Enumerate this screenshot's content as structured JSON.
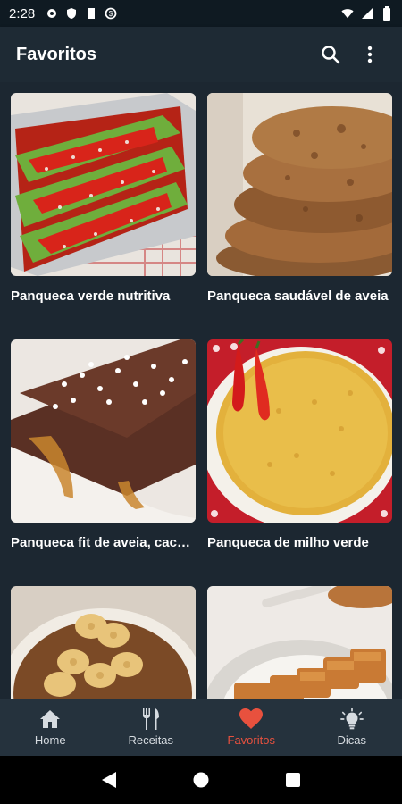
{
  "status_bar": {
    "time": "2:28"
  },
  "app_bar": {
    "title": "Favoritos",
    "icons": [
      "search-icon",
      "more-vert-icon"
    ]
  },
  "recipes": [
    {
      "title": "Panqueca verde nutritiva"
    },
    {
      "title": "Panqueca saudável de aveia"
    },
    {
      "title": "Panqueca fit de aveia, cacau e coco"
    },
    {
      "title": "Panqueca de milho verde"
    },
    {
      "title": ""
    },
    {
      "title": ""
    }
  ],
  "bottom_nav": {
    "items": [
      {
        "label": "Home",
        "icon": "home-icon"
      },
      {
        "label": "Receitas",
        "icon": "fork-knife-icon"
      },
      {
        "label": "Favoritos",
        "icon": "heart-icon",
        "active": true
      },
      {
        "label": "Dicas",
        "icon": "lightbulb-icon"
      }
    ],
    "active_color": "#e8513e"
  },
  "colors": {
    "background": "#1c2731",
    "app_bar": "#1e2a34",
    "bottom_nav": "#25323d"
  }
}
